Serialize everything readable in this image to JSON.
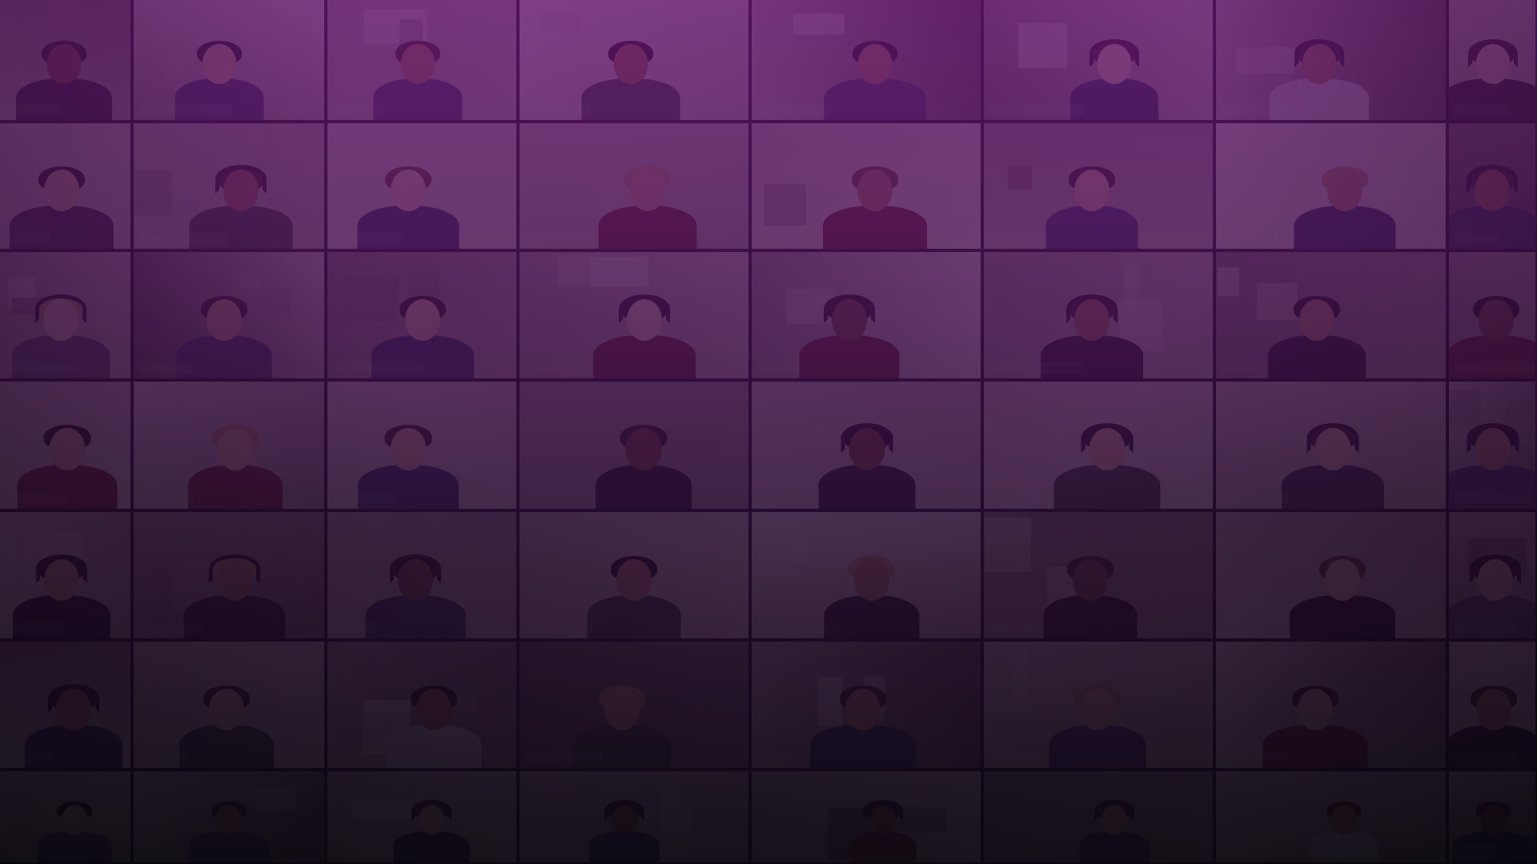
{
  "scene": {
    "description_free": true,
    "colors": {
      "tint_top": "#62146e",
      "tint_mid": "#4a1056",
      "tint_bottom": "#0e0814",
      "grid_gap": "#0a0810"
    },
    "grid": {
      "columns": 8,
      "rows": 7
    }
  }
}
